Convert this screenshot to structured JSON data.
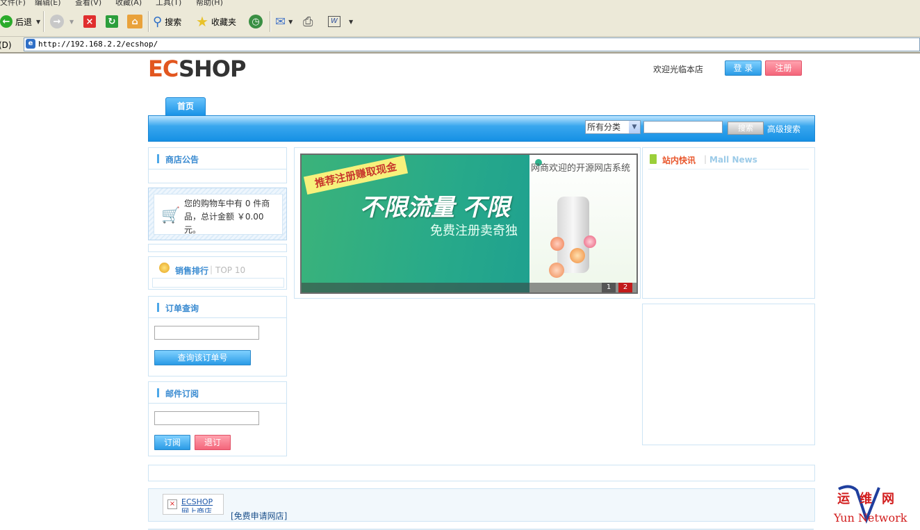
{
  "browser": {
    "menu": [
      "文件(F)",
      "编辑(E)",
      "查看(V)",
      "收藏(A)",
      "工具(T)",
      "帮助(H)"
    ],
    "toolbar": {
      "back_label": "后退",
      "search_label": "搜索",
      "favorites_label": "收藏夹"
    },
    "address": {
      "label": "地址(D)",
      "url": "http://192.168.2.2/ecshop/"
    }
  },
  "header": {
    "logo_ec": "EC",
    "logo_shop": "SHOP",
    "welcome": "欢迎光临本店",
    "login_label": "登 录",
    "register_label": "注册"
  },
  "nav": {
    "tab_home": "首页",
    "category_selected": "所有分类",
    "search_button": "搜索",
    "advanced_search": "高级搜索"
  },
  "sidebar": {
    "notice_title": "商店公告",
    "cart_text": "您的购物车中有 0 件商品，总计金额 ￥0.00元。",
    "top_sales_title": "销售排行",
    "top_sales_sub": "TOP 10",
    "order_title": "订单查询",
    "order_button": "查询该订单号",
    "mail_title": "邮件订阅",
    "subscribe_label": "订阅",
    "unsubscribe_label": "退订"
  },
  "banner": {
    "tag": "推荐注册赚取现金",
    "headline": "不限流量 不限",
    "subline": "免费注册卖奇独",
    "top_text": "网商欢迎的开源网店系统",
    "pages": [
      "1",
      "2"
    ]
  },
  "news": {
    "title": "站内快讯",
    "subtitle": "Mall News"
  },
  "footer": {
    "ecshop_label": "ECSHOP",
    "ecshop_label2": "网上商店",
    "free_apply": "[免费申请网店]"
  },
  "watermark": {
    "cn": "运维网",
    "en": "Yun Network"
  },
  "colors": {
    "accent_blue": "#1590e4",
    "accent_red": "#f4657a",
    "logo_orange": "#e2561f"
  }
}
